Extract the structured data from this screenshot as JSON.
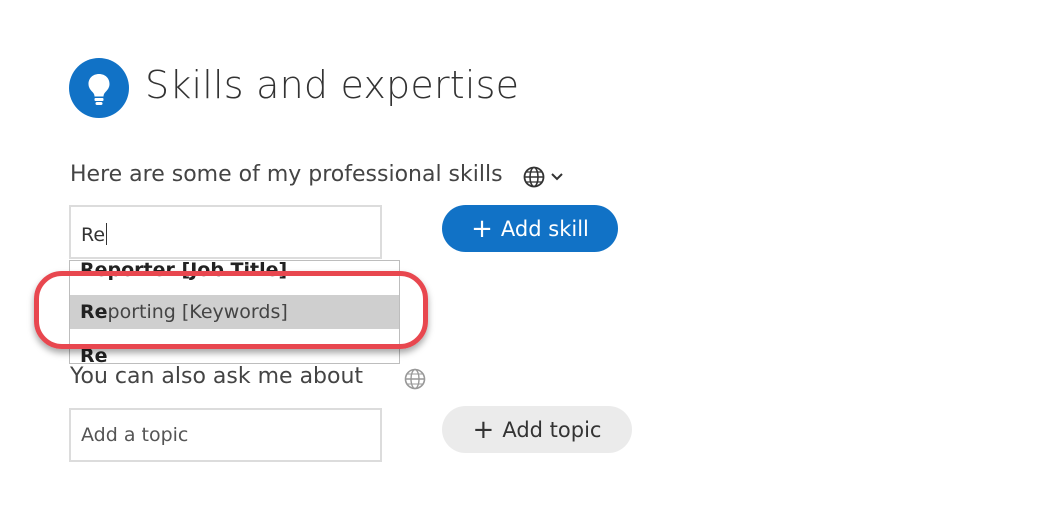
{
  "header": {
    "title": "Skills and expertise",
    "icon": "lightbulb-icon",
    "accent_color": "#1172c6"
  },
  "skills": {
    "label": "Here are some of my professional skills",
    "input_value": "Re",
    "add_button_label": "Add skill",
    "language_icon": "globe-icon",
    "suggestions": [
      {
        "match": "Re",
        "rest": "porter [Job Title]"
      },
      {
        "match": "Re",
        "rest": "porting [Keywords]"
      },
      {
        "match": "Re",
        "rest": ""
      }
    ]
  },
  "topics": {
    "label": "You can also ask me about",
    "placeholder": "Add a topic",
    "add_button_label": "Add topic",
    "language_icon": "globe-icon"
  },
  "annotation": {
    "highlight_color": "#e8474f"
  }
}
